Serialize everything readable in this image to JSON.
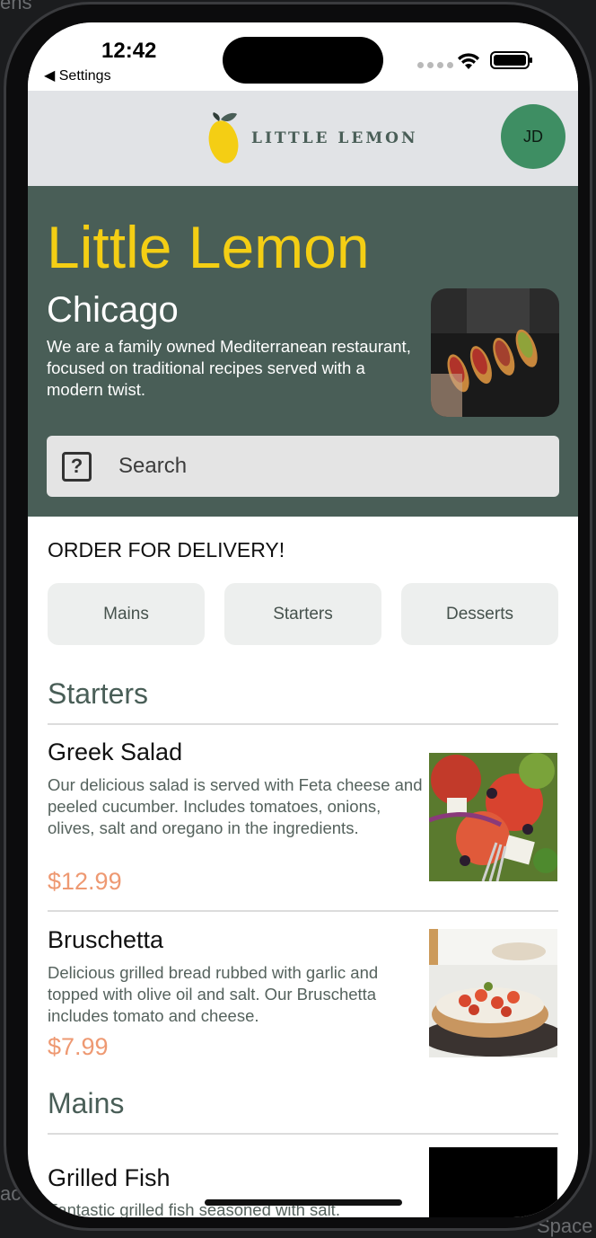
{
  "status_bar": {
    "time": "12:42",
    "back_label": "◀ Settings"
  },
  "header": {
    "logo_text": "LITTLE LEMON",
    "avatar_initials": "JD"
  },
  "hero": {
    "title": "Little Lemon",
    "city": "Chicago",
    "description": "We are a family owned Mediterranean restaurant, focused on traditional recipes served with a modern twist.",
    "search_placeholder": "Search"
  },
  "order": {
    "title": "ORDER FOR DELIVERY!",
    "categories": [
      {
        "label": "Mains"
      },
      {
        "label": "Starters"
      },
      {
        "label": "Desserts"
      }
    ]
  },
  "menu": {
    "sections": [
      {
        "title": "Starters",
        "items": [
          {
            "name": "Greek Salad",
            "description": "Our delicious salad is served with Feta cheese and peeled cucumber. Includes tomatoes, onions, olives, salt and oregano in the ingredients.",
            "price": "$12.99"
          },
          {
            "name": "Bruschetta",
            "description": "Delicious grilled bread rubbed with garlic and topped with olive oil and salt. Our Bruschetta includes tomato and cheese.",
            "price": "$7.99"
          }
        ]
      },
      {
        "title": "Mains",
        "items": [
          {
            "name": "Grilled Fish",
            "description": "Fantastic grilled fish seasoned with salt."
          }
        ]
      }
    ]
  },
  "colors": {
    "primary_green": "#495e57",
    "primary_yellow": "#f4ce14",
    "price_orange": "#ee9972",
    "avatar_green": "#3e8e63"
  }
}
